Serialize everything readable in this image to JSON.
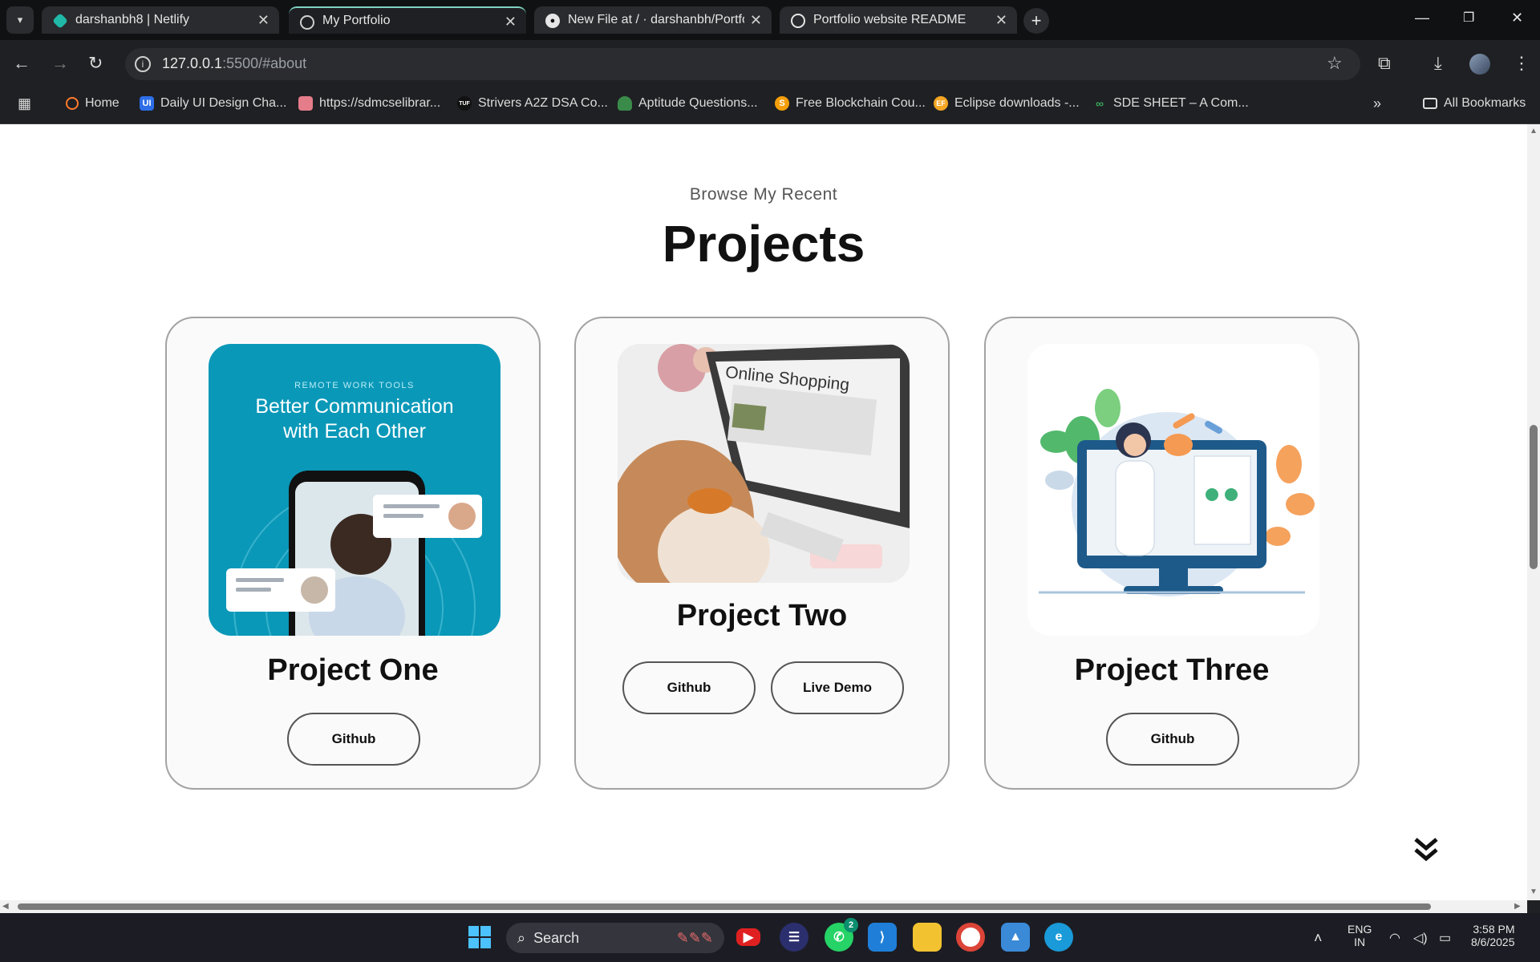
{
  "browser": {
    "tabs": [
      {
        "label": "darshanbh8 | Netlify",
        "icon": "netlify-icon",
        "active": false
      },
      {
        "label": "My Portfolio",
        "icon": "globe-icon",
        "active": true
      },
      {
        "label": "New File at / · darshanbh/Portfo",
        "icon": "github-icon",
        "active": false
      },
      {
        "label": "Portfolio website README",
        "icon": "chatgpt-icon",
        "active": false
      }
    ],
    "url_host": "127.0.0.1",
    "url_rest": ":5500/#about",
    "bookmarks": [
      {
        "label": "Home",
        "icon": "home-bookmark-icon"
      },
      {
        "label": "Daily UI Design Cha...",
        "icon": "ui-bookmark-icon"
      },
      {
        "label": "https://sdmcselibrar...",
        "icon": "library-bookmark-icon"
      },
      {
        "label": "Strivers A2Z DSA Co...",
        "icon": "tuf-bookmark-icon"
      },
      {
        "label": "Aptitude Questions...",
        "icon": "aptitude-bookmark-icon"
      },
      {
        "label": "Free Blockchain Cou...",
        "icon": "blockchain-bookmark-icon"
      },
      {
        "label": "Eclipse downloads -...",
        "icon": "eclipse-bookmark-icon"
      },
      {
        "label": "SDE SHEET – A Com...",
        "icon": "sde-bookmark-icon"
      }
    ],
    "all_bookmarks": "All Bookmarks"
  },
  "section": {
    "subtitle": "Browse My Recent",
    "title": "Projects"
  },
  "projects": [
    {
      "title": "Project One",
      "buttons": [
        "Github"
      ],
      "image": {
        "tag": "REMOTE WORK TOOLS",
        "line1": "Better Communication",
        "line2": "with Each Other",
        "bg": "#0a98b8"
      }
    },
    {
      "title": "Project Two",
      "buttons": [
        "Github",
        "Live Demo"
      ],
      "image": {
        "screen_text": "Online Shopping"
      }
    },
    {
      "title": "Project Three",
      "buttons": [
        "Github"
      ],
      "image": {
        "theme": "doctor-telehealth-illustration"
      }
    }
  ],
  "taskbar": {
    "search": "Search",
    "whatsapp_badge": "2",
    "lang_line1": "ENG",
    "lang_line2": "IN",
    "time": "3:58 PM",
    "date": "8/6/2025"
  },
  "colors": {
    "chrome_bg": "#1f2023",
    "tab_accent": "#7fd3c4",
    "page_bg": "#ffffff",
    "card_bg": "#fafafa",
    "card_border": "#a3a3a3"
  }
}
